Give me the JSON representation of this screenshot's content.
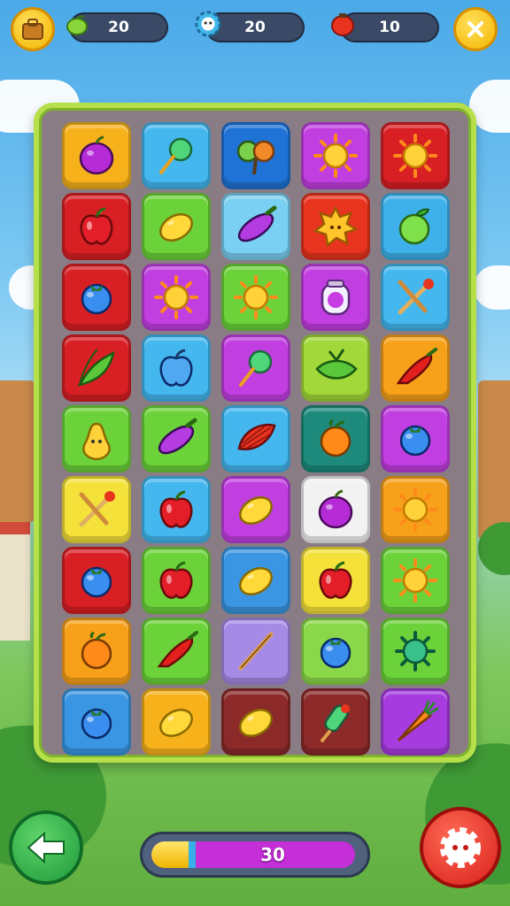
{
  "hud": {
    "fruit_count": "20",
    "gem_count": "20",
    "lantern_count": "10",
    "bag_icon": "bag-icon",
    "close_icon": "close-icon"
  },
  "colors": {
    "board_border": "#b6e04a",
    "progress_fill": "#f0b400",
    "progress_track": "#c42fd8"
  },
  "progress": {
    "label": "30",
    "fraction": 0.2
  },
  "board": {
    "rows": [
      [
        {
          "c": "#f7b21b",
          "i": "plum"
        },
        {
          "c": "#44b7ee",
          "i": "lollipop"
        },
        {
          "c": "#1f73d6",
          "i": "cherry"
        },
        {
          "c": "#c13fe0",
          "i": "sun"
        },
        {
          "c": "#d81f24",
          "i": "sun"
        }
      ],
      [
        {
          "c": "#d81f24",
          "i": "apple"
        },
        {
          "c": "#6cd23a",
          "i": "lemon"
        },
        {
          "c": "#7ad0f2",
          "i": "eggplant"
        },
        {
          "c": "#e8341e",
          "i": "leaf-sun"
        },
        {
          "c": "#3fb1ea",
          "i": "green-apple"
        }
      ],
      [
        {
          "c": "#d81f24",
          "i": "blueberry"
        },
        {
          "c": "#c13fe0",
          "i": "sun"
        },
        {
          "c": "#6cd23a",
          "i": "sun"
        },
        {
          "c": "#c13fe0",
          "i": "jar"
        },
        {
          "c": "#44b7ee",
          "i": "sticks"
        }
      ],
      [
        {
          "c": "#d81f24",
          "i": "leaves"
        },
        {
          "c": "#44b7ee",
          "i": "blue-apple"
        },
        {
          "c": "#c13fe0",
          "i": "lollipop"
        },
        {
          "c": "#a2d83a",
          "i": "leaf"
        },
        {
          "c": "#f7a11b",
          "i": "chili"
        }
      ],
      [
        {
          "c": "#6cd23a",
          "i": "pear"
        },
        {
          "c": "#6cd23a",
          "i": "eggplant"
        },
        {
          "c": "#44b7ee",
          "i": "fan"
        },
        {
          "c": "#1d8a7c",
          "i": "orange"
        },
        {
          "c": "#c13fe0",
          "i": "blueberry"
        }
      ],
      [
        {
          "c": "#f4e23a",
          "i": "sticks"
        },
        {
          "c": "#44b7ee",
          "i": "apple"
        },
        {
          "c": "#c13fe0",
          "i": "lemon"
        },
        {
          "c": "#f2f2f2",
          "i": "plum"
        },
        {
          "c": "#f7a11b",
          "i": "sun"
        }
      ],
      [
        {
          "c": "#d81f24",
          "i": "blueberry"
        },
        {
          "c": "#6cd23a",
          "i": "apple"
        },
        {
          "c": "#3a96e2",
          "i": "lemon"
        },
        {
          "c": "#f4e23a",
          "i": "apple"
        },
        {
          "c": "#6cd23a",
          "i": "sun"
        }
      ],
      [
        {
          "c": "#f7a11b",
          "i": "orange"
        },
        {
          "c": "#6cd23a",
          "i": "chili"
        },
        {
          "c": "#a68be6",
          "i": "stick"
        },
        {
          "c": "#8ad84a",
          "i": "blueberry"
        },
        {
          "c": "#6cd23a",
          "i": "urchin"
        }
      ],
      [
        {
          "c": "#3a96e2",
          "i": "blueberry"
        },
        {
          "c": "#f7b21b",
          "i": "lemon"
        },
        {
          "c": "#8c2a2a",
          "i": "lemon"
        },
        {
          "c": "#8c2a2a",
          "i": "popsicle"
        },
        {
          "c": "#a63ce0",
          "i": "carrot"
        }
      ]
    ]
  }
}
